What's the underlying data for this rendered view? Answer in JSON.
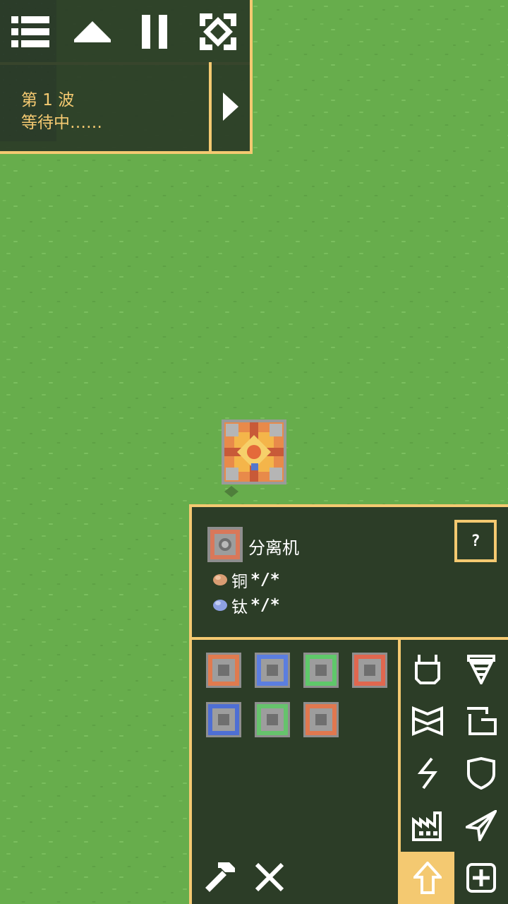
{
  "colors": {
    "accent": "#f4c971",
    "panel": "#2c3d27",
    "ground": "#67ad4c",
    "copper": "#d99d73",
    "titanium": "#8da1e3"
  },
  "toolbar": {
    "menu_icon": "menu-icon",
    "database_icon": "up-arrow-icon",
    "pause_icon": "pause-icon",
    "minimap_icon": "target-icon"
  },
  "wave": {
    "title": "第 1 波",
    "status": "等待中……",
    "skip_icon": "play-icon"
  },
  "block_info": {
    "name": "分离机",
    "help_label": "?",
    "requirements": [
      {
        "item": "铜",
        "amount": "*/*",
        "icon": "copper-icon"
      },
      {
        "item": "钛",
        "amount": "*/*",
        "icon": "titanium-icon"
      }
    ]
  },
  "block_grid": {
    "blocks": [
      {
        "name": "separator",
        "accent": "#e07b4f"
      },
      {
        "name": "disassembler",
        "accent": "#5b7ee0"
      },
      {
        "name": "pulverizer",
        "accent": "#5fc86a"
      },
      {
        "name": "melter",
        "accent": "#e0674f"
      },
      {
        "name": "cultivator",
        "accent": "#4e6fd4"
      },
      {
        "name": "spore-press",
        "accent": "#66c36c"
      },
      {
        "name": "incinerator",
        "accent": "#e0784f"
      }
    ]
  },
  "tools": {
    "hammer_icon": "hammer-icon",
    "cancel_icon": "close-icon"
  },
  "categories": [
    {
      "name": "turret-category",
      "icon": "turret-icon",
      "active": false
    },
    {
      "name": "production-category",
      "icon": "drill-icon",
      "active": false
    },
    {
      "name": "distribution-category",
      "icon": "conveyor-icon",
      "active": false
    },
    {
      "name": "liquid-category",
      "icon": "pipe-icon",
      "active": false
    },
    {
      "name": "power-category",
      "icon": "power-icon",
      "active": false
    },
    {
      "name": "defense-category",
      "icon": "shield-icon",
      "active": false
    },
    {
      "name": "crafting-category",
      "icon": "factory-icon",
      "active": false
    },
    {
      "name": "units-category",
      "icon": "plane-icon",
      "active": false
    },
    {
      "name": "upgrade-category",
      "icon": "up-arrow-icon",
      "active": true
    },
    {
      "name": "effect-category",
      "icon": "plus-icon",
      "active": false
    }
  ]
}
